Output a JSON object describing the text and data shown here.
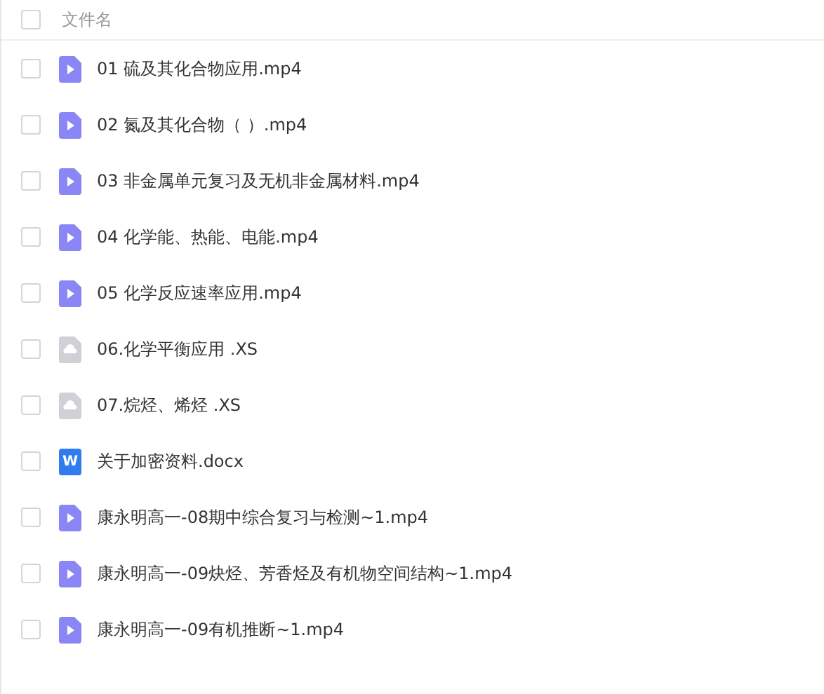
{
  "header": {
    "label": "文件名",
    "checked": false
  },
  "files": [
    {
      "name": "01 硫及其化合物应用.mp4",
      "kind": "video",
      "checked": false
    },
    {
      "name": "02 氮及其化合物（  ）.mp4",
      "kind": "video",
      "checked": false
    },
    {
      "name": "03 非金属单元复习及无机非金属材料.mp4",
      "kind": "video",
      "checked": false
    },
    {
      "name": "04 化学能、热能、电能.mp4",
      "kind": "video",
      "checked": false
    },
    {
      "name": "05 化学反应速率应用.mp4",
      "kind": "video",
      "checked": false
    },
    {
      "name": "06.化学平衡应用  .XS",
      "kind": "cloud",
      "checked": false
    },
    {
      "name": "07.烷烃、烯烃  .XS",
      "kind": "cloud",
      "checked": false
    },
    {
      "name": "关于加密资料.docx",
      "kind": "word",
      "badge": "W",
      "checked": false
    },
    {
      "name": "康永明高一-08期中综合复习与检测~1.mp4",
      "kind": "video",
      "checked": false
    },
    {
      "name": "康永明高一-09炔烃、芳香烃及有机物空间结构~1.mp4",
      "kind": "video",
      "checked": false
    },
    {
      "name": "康永明高一-09有机推断~1.mp4",
      "kind": "video",
      "checked": false
    }
  ]
}
